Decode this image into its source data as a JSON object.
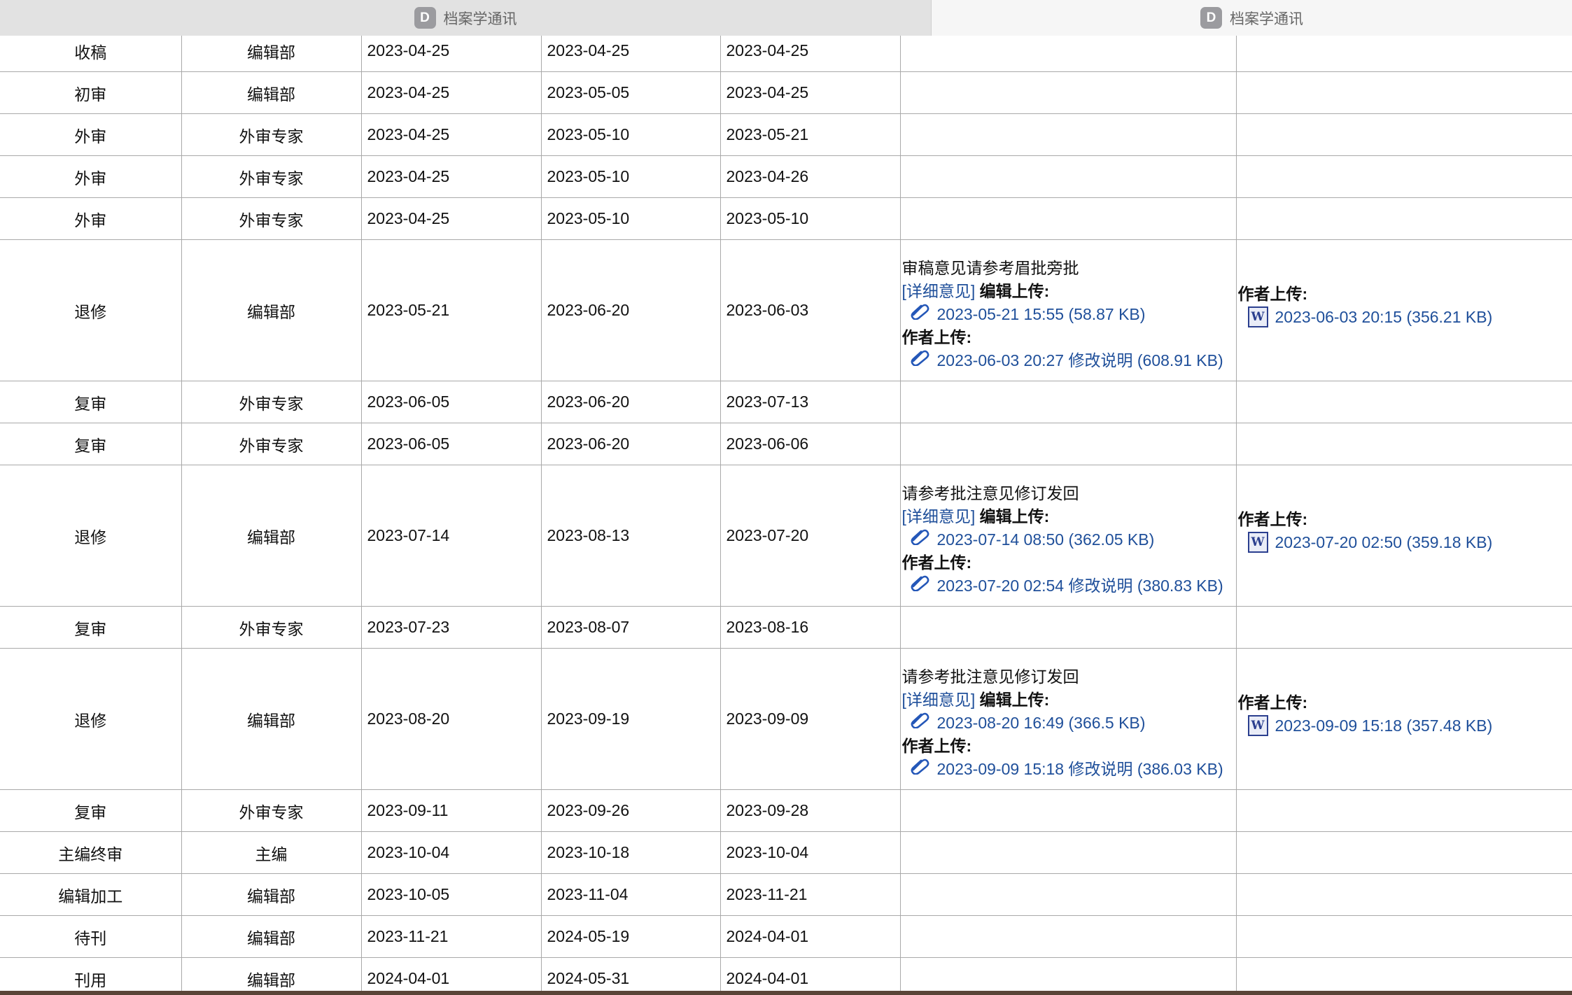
{
  "tabs": [
    {
      "favicon": "D",
      "title": "档案学通讯",
      "active": true
    },
    {
      "favicon": "D",
      "title": "档案学通讯",
      "active": false
    }
  ],
  "rows": [
    {
      "stage": "收稿",
      "party": "编辑部",
      "received": "2023-04-25",
      "due": "2023-04-25",
      "completed": "2023-04-25"
    },
    {
      "stage": "初审",
      "party": "编辑部",
      "received": "2023-04-25",
      "due": "2023-05-05",
      "completed": "2023-04-25"
    },
    {
      "stage": "外审",
      "party": "外审专家",
      "received": "2023-04-25",
      "due": "2023-05-10",
      "completed": "2023-05-21"
    },
    {
      "stage": "外审",
      "party": "外审专家",
      "received": "2023-04-25",
      "due": "2023-05-10",
      "completed": "2023-04-26"
    },
    {
      "stage": "外审",
      "party": "外审专家",
      "received": "2023-04-25",
      "due": "2023-05-10",
      "completed": "2023-05-10"
    },
    {
      "stage": "退修",
      "party": "编辑部",
      "received": "2023-05-21",
      "due": "2023-06-20",
      "completed": "2023-06-03",
      "remark": {
        "opinion": "审稿意见请参考眉批旁批",
        "detail_link": "[详细意见]",
        "editor_label": "编辑上传:",
        "editor_file": "2023-05-21 15:55 (58.87 KB)",
        "author_label": "作者上传:",
        "author_file": "2023-06-03 20:27 修改说明 (608.91 KB)"
      },
      "attachment": {
        "label": "作者上传:",
        "file": "2023-06-03 20:15 (356.21 KB)",
        "icon": "word-doc-icon"
      }
    },
    {
      "stage": "复审",
      "party": "外审专家",
      "received": "2023-06-05",
      "due": "2023-06-20",
      "completed": "2023-07-13"
    },
    {
      "stage": "复审",
      "party": "外审专家",
      "received": "2023-06-05",
      "due": "2023-06-20",
      "completed": "2023-06-06"
    },
    {
      "stage": "退修",
      "party": "编辑部",
      "received": "2023-07-14",
      "due": "2023-08-13",
      "completed": "2023-07-20",
      "remark": {
        "opinion": "请参考批注意见修订发回",
        "detail_link": "[详细意见]",
        "editor_label": "编辑上传:",
        "editor_file": "2023-07-14 08:50 (362.05 KB)",
        "author_label": "作者上传:",
        "author_file": "2023-07-20 02:54 修改说明 (380.83 KB)"
      },
      "attachment": {
        "label": "作者上传:",
        "file": "2023-07-20 02:50 (359.18 KB)",
        "icon": "word-doc-icon"
      }
    },
    {
      "stage": "复审",
      "party": "外审专家",
      "received": "2023-07-23",
      "due": "2023-08-07",
      "completed": "2023-08-16"
    },
    {
      "stage": "退修",
      "party": "编辑部",
      "received": "2023-08-20",
      "due": "2023-09-19",
      "completed": "2023-09-09",
      "remark": {
        "opinion": "请参考批注意见修订发回",
        "detail_link": "[详细意见]",
        "editor_label": "编辑上传:",
        "editor_file": "2023-08-20 16:49 (366.5 KB)",
        "author_label": "作者上传:",
        "author_file": "2023-09-09 15:18 修改说明 (386.03 KB)"
      },
      "attachment": {
        "label": "作者上传:",
        "file": "2023-09-09 15:18 (357.48 KB)",
        "icon": "word-doc-icon"
      }
    },
    {
      "stage": "复审",
      "party": "外审专家",
      "received": "2023-09-11",
      "due": "2023-09-26",
      "completed": "2023-09-28"
    },
    {
      "stage": "主编终审",
      "party": "主编",
      "received": "2023-10-04",
      "due": "2023-10-18",
      "completed": "2023-10-04"
    },
    {
      "stage": "编辑加工",
      "party": "编辑部",
      "received": "2023-10-05",
      "due": "2023-11-04",
      "completed": "2023-11-21"
    },
    {
      "stage": "待刊",
      "party": "编辑部",
      "received": "2023-11-21",
      "due": "2024-05-19",
      "completed": "2024-04-01"
    },
    {
      "stage": "刊用",
      "party": "编辑部",
      "received": "2024-04-01",
      "due": "2024-05-31",
      "completed": "2024-04-01"
    }
  ],
  "colors": {
    "link": "#1f4f9a",
    "border": "#a9a9a9",
    "tab_active": "#e2e2e2",
    "tab_inactive": "#f6f6f6",
    "favicon": "#9b9b9f"
  }
}
